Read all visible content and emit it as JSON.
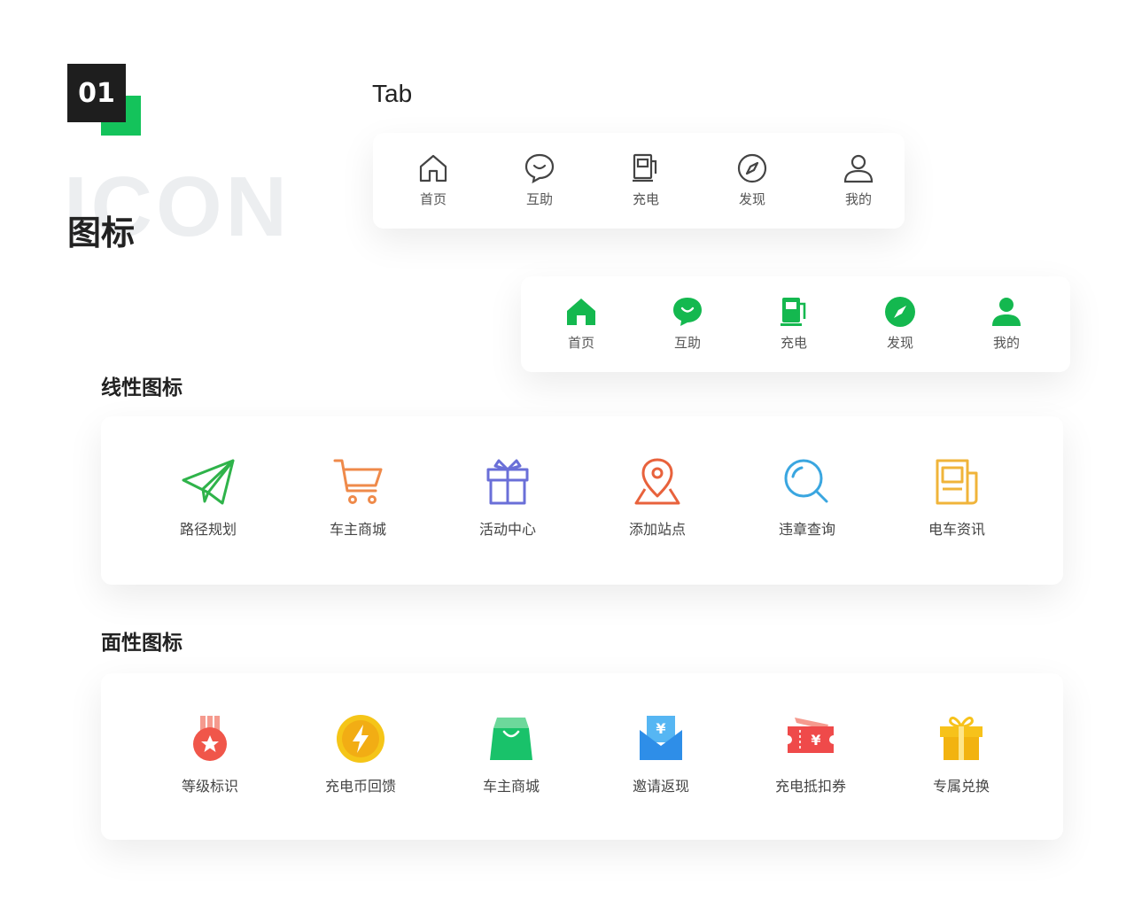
{
  "header": {
    "number": "01",
    "watermark": "ICON",
    "title": "图标",
    "tab_heading": "Tab"
  },
  "tab_bar_outline": {
    "items": [
      {
        "label": "首页",
        "icon": "home-icon"
      },
      {
        "label": "互助",
        "icon": "chat-smile-icon"
      },
      {
        "label": "充电",
        "icon": "fuel-pump-icon"
      },
      {
        "label": "发现",
        "icon": "compass-icon"
      },
      {
        "label": "我的",
        "icon": "user-icon"
      }
    ],
    "color": "#444444"
  },
  "tab_bar_filled": {
    "items": [
      {
        "label": "首页",
        "icon": "home-icon"
      },
      {
        "label": "互助",
        "icon": "chat-smile-icon"
      },
      {
        "label": "充电",
        "icon": "fuel-pump-icon"
      },
      {
        "label": "发现",
        "icon": "compass-icon"
      },
      {
        "label": "我的",
        "icon": "user-icon"
      }
    ],
    "color": "#14b84f"
  },
  "linear_icons": {
    "title": "线性图标",
    "items": [
      {
        "label": "路径规划",
        "icon": "paper-plane-icon",
        "color": "#2fb34a"
      },
      {
        "label": "车主商城",
        "icon": "shopping-cart-icon",
        "color": "#ef8a4a"
      },
      {
        "label": "活动中心",
        "icon": "gift-icon",
        "color": "#6a6fd8"
      },
      {
        "label": "添加站点",
        "icon": "map-pin-icon",
        "color": "#e8623c"
      },
      {
        "label": "违章查询",
        "icon": "search-icon",
        "color": "#3aa6e0"
      },
      {
        "label": "电车资讯",
        "icon": "newspaper-icon",
        "color": "#f0b43a"
      }
    ]
  },
  "filled_icons": {
    "title": "面性图标",
    "items": [
      {
        "label": "等级标识",
        "icon": "medal-icon",
        "color": "#f0564a"
      },
      {
        "label": "充电币回馈",
        "icon": "lightning-coin-icon",
        "color": "#f5c518"
      },
      {
        "label": "车主商城",
        "icon": "shopping-bag-icon",
        "color": "#19c26a"
      },
      {
        "label": "邀请返现",
        "icon": "yuan-envelope-icon",
        "color": "#2e8ee8"
      },
      {
        "label": "充电抵扣券",
        "icon": "yuan-ticket-icon",
        "color": "#ef4a4a"
      },
      {
        "label": "专属兑换",
        "icon": "gift-box-icon",
        "color": "#f7c21a"
      }
    ]
  }
}
